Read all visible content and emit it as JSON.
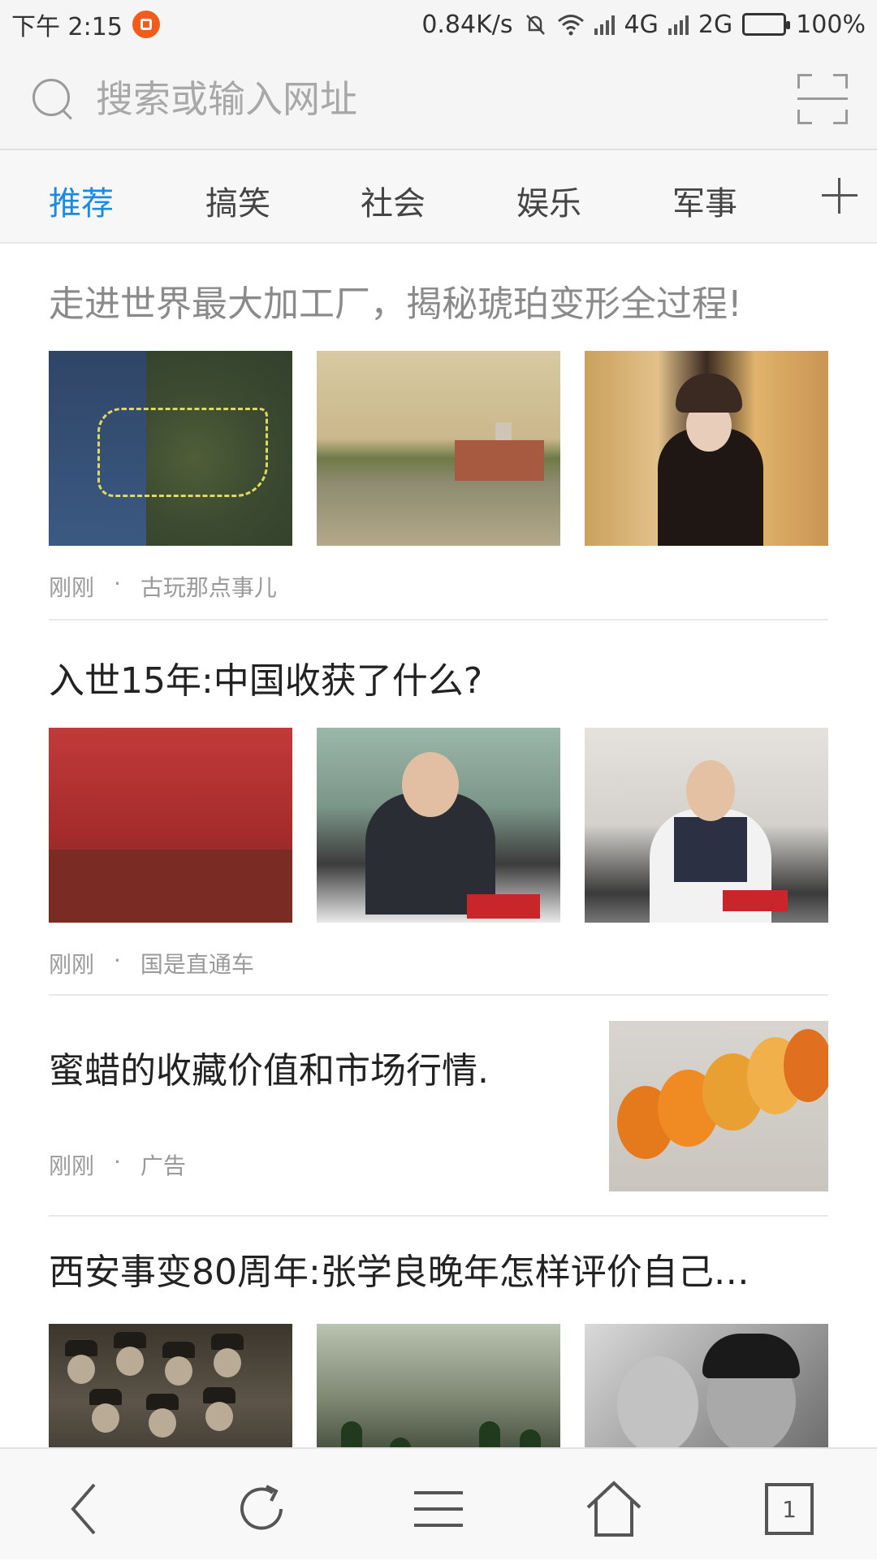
{
  "status_bar": {
    "time": "下午 2:15",
    "speed": "0.84K/s",
    "net1": "4G",
    "net2": "2G",
    "battery": "100%"
  },
  "search": {
    "placeholder": "搜索或输入网址",
    "search_icon": "search-icon",
    "scan_icon": "scan-icon"
  },
  "tabs": [
    {
      "label": "推荐",
      "active": true
    },
    {
      "label": "搞笑",
      "active": false
    },
    {
      "label": "社会",
      "active": false
    },
    {
      "label": "娱乐",
      "active": false
    },
    {
      "label": "军事",
      "active": false
    }
  ],
  "feed": [
    {
      "title": "走进世界最大加工厂，揭秘琥珀变形全过程!",
      "read": true,
      "time": "刚刚",
      "source": "古玩那点事儿"
    },
    {
      "title": "入世15年:中国收获了什么?",
      "read": false,
      "time": "刚刚",
      "source": "国是直通车"
    },
    {
      "title": "蜜蜡的收藏价值和市场行情.",
      "read": false,
      "time": "刚刚",
      "source": "广告"
    },
    {
      "title": "西安事变80周年:张学良晚年怎样评价自己…",
      "read": false
    }
  ],
  "bottom_nav": {
    "tab_count": "1",
    "icons": [
      "back-icon",
      "refresh-icon",
      "menu-icon",
      "home-icon",
      "tabs-icon"
    ]
  },
  "colors": {
    "accent": "#1a8be5",
    "read_text": "#8a8a8a"
  }
}
